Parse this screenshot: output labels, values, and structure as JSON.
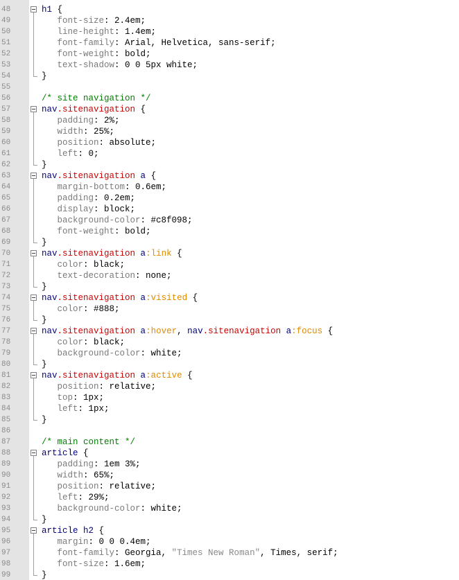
{
  "window": {
    "title": ""
  },
  "editor": {
    "lines": [
      {
        "n": "48",
        "fold": "start",
        "tokens": [
          {
            "t": "h1",
            "c": "sel"
          },
          {
            "t": " {",
            "c": "pun"
          }
        ]
      },
      {
        "n": "49",
        "fold": "mid",
        "tokens": [
          {
            "t": "   font-size",
            "c": "prop"
          },
          {
            "t": ": 2.4em;",
            "c": "val"
          }
        ]
      },
      {
        "n": "50",
        "fold": "mid",
        "tokens": [
          {
            "t": "   line-height",
            "c": "prop"
          },
          {
            "t": ": 1.4em;",
            "c": "val"
          }
        ]
      },
      {
        "n": "51",
        "fold": "mid",
        "tokens": [
          {
            "t": "   font-family",
            "c": "prop"
          },
          {
            "t": ": Arial, Helvetica, sans-serif;",
            "c": "val"
          }
        ]
      },
      {
        "n": "52",
        "fold": "mid",
        "tokens": [
          {
            "t": "   font-weight",
            "c": "prop"
          },
          {
            "t": ": bold;",
            "c": "val"
          }
        ]
      },
      {
        "n": "53",
        "fold": "mid",
        "tokens": [
          {
            "t": "   text-shadow",
            "c": "prop"
          },
          {
            "t": ": 0 0 5px white;",
            "c": "val"
          }
        ]
      },
      {
        "n": "54",
        "fold": "end",
        "tokens": [
          {
            "t": "}",
            "c": "pun"
          }
        ]
      },
      {
        "n": "55",
        "fold": "none",
        "tokens": []
      },
      {
        "n": "56",
        "fold": "none",
        "tokens": [
          {
            "t": "/* site navigation */",
            "c": "cmt"
          }
        ]
      },
      {
        "n": "57",
        "fold": "start",
        "tokens": [
          {
            "t": "nav",
            "c": "sel"
          },
          {
            "t": ".sitenavigation",
            "c": "cls"
          },
          {
            "t": " {",
            "c": "pun"
          }
        ]
      },
      {
        "n": "58",
        "fold": "mid",
        "tokens": [
          {
            "t": "   padding",
            "c": "prop"
          },
          {
            "t": ": 2%;",
            "c": "val"
          }
        ]
      },
      {
        "n": "59",
        "fold": "mid",
        "tokens": [
          {
            "t": "   width",
            "c": "prop"
          },
          {
            "t": ": 25%;",
            "c": "val"
          }
        ]
      },
      {
        "n": "60",
        "fold": "mid",
        "tokens": [
          {
            "t": "   position",
            "c": "prop"
          },
          {
            "t": ": absolute;",
            "c": "val"
          }
        ]
      },
      {
        "n": "61",
        "fold": "mid",
        "tokens": [
          {
            "t": "   left",
            "c": "prop"
          },
          {
            "t": ": 0;",
            "c": "val"
          }
        ]
      },
      {
        "n": "62",
        "fold": "end",
        "tokens": [
          {
            "t": "}",
            "c": "pun"
          }
        ]
      },
      {
        "n": "63",
        "fold": "start",
        "tokens": [
          {
            "t": "nav",
            "c": "sel"
          },
          {
            "t": ".sitenavigation",
            "c": "cls"
          },
          {
            "t": " a",
            "c": "sel"
          },
          {
            "t": " {",
            "c": "pun"
          }
        ]
      },
      {
        "n": "64",
        "fold": "mid",
        "tokens": [
          {
            "t": "   margin-bottom",
            "c": "prop"
          },
          {
            "t": ": 0.6em;",
            "c": "val"
          }
        ]
      },
      {
        "n": "65",
        "fold": "mid",
        "tokens": [
          {
            "t": "   padding",
            "c": "prop"
          },
          {
            "t": ": 0.2em;",
            "c": "val"
          }
        ]
      },
      {
        "n": "66",
        "fold": "mid",
        "tokens": [
          {
            "t": "   display",
            "c": "prop"
          },
          {
            "t": ": block;",
            "c": "val"
          }
        ]
      },
      {
        "n": "67",
        "fold": "mid",
        "tokens": [
          {
            "t": "   background-color",
            "c": "prop"
          },
          {
            "t": ": #c8f098;",
            "c": "val"
          }
        ]
      },
      {
        "n": "68",
        "fold": "mid",
        "tokens": [
          {
            "t": "   font-weight",
            "c": "prop"
          },
          {
            "t": ": bold;",
            "c": "val"
          }
        ]
      },
      {
        "n": "69",
        "fold": "end",
        "tokens": [
          {
            "t": "}",
            "c": "pun"
          }
        ]
      },
      {
        "n": "70",
        "fold": "start",
        "tokens": [
          {
            "t": "nav",
            "c": "sel"
          },
          {
            "t": ".sitenavigation",
            "c": "cls"
          },
          {
            "t": " a",
            "c": "sel"
          },
          {
            "t": ":link",
            "c": "pseudo"
          },
          {
            "t": " {",
            "c": "pun"
          }
        ]
      },
      {
        "n": "71",
        "fold": "mid",
        "tokens": [
          {
            "t": "   color",
            "c": "prop"
          },
          {
            "t": ": black;",
            "c": "val"
          }
        ]
      },
      {
        "n": "72",
        "fold": "mid",
        "tokens": [
          {
            "t": "   text-decoration",
            "c": "prop"
          },
          {
            "t": ": none;",
            "c": "val"
          }
        ]
      },
      {
        "n": "73",
        "fold": "end",
        "tokens": [
          {
            "t": "}",
            "c": "pun"
          }
        ]
      },
      {
        "n": "74",
        "fold": "start",
        "tokens": [
          {
            "t": "nav",
            "c": "sel"
          },
          {
            "t": ".sitenavigation",
            "c": "cls"
          },
          {
            "t": " a",
            "c": "sel"
          },
          {
            "t": ":visited",
            "c": "pseudo"
          },
          {
            "t": " {",
            "c": "pun"
          }
        ]
      },
      {
        "n": "75",
        "fold": "mid",
        "tokens": [
          {
            "t": "   color",
            "c": "prop"
          },
          {
            "t": ": #888;",
            "c": "val"
          }
        ]
      },
      {
        "n": "76",
        "fold": "end",
        "tokens": [
          {
            "t": "}",
            "c": "pun"
          }
        ]
      },
      {
        "n": "77",
        "fold": "start",
        "tokens": [
          {
            "t": "nav",
            "c": "sel"
          },
          {
            "t": ".sitenavigation",
            "c": "cls"
          },
          {
            "t": " a",
            "c": "sel"
          },
          {
            "t": ":hover",
            "c": "pseudo"
          },
          {
            "t": ", ",
            "c": "pun"
          },
          {
            "t": "nav",
            "c": "sel"
          },
          {
            "t": ".sitenavigation",
            "c": "cls"
          },
          {
            "t": " a",
            "c": "sel"
          },
          {
            "t": ":focus",
            "c": "pseudo"
          },
          {
            "t": " {",
            "c": "pun"
          }
        ]
      },
      {
        "n": "78",
        "fold": "mid",
        "tokens": [
          {
            "t": "   color",
            "c": "prop"
          },
          {
            "t": ": black;",
            "c": "val"
          }
        ]
      },
      {
        "n": "79",
        "fold": "mid",
        "tokens": [
          {
            "t": "   background-color",
            "c": "prop"
          },
          {
            "t": ": white;",
            "c": "val"
          }
        ]
      },
      {
        "n": "80",
        "fold": "end",
        "tokens": [
          {
            "t": "}",
            "c": "pun"
          }
        ]
      },
      {
        "n": "81",
        "fold": "start",
        "tokens": [
          {
            "t": "nav",
            "c": "sel"
          },
          {
            "t": ".sitenavigation",
            "c": "cls"
          },
          {
            "t": " a",
            "c": "sel"
          },
          {
            "t": ":active",
            "c": "pseudo"
          },
          {
            "t": " {",
            "c": "pun"
          }
        ]
      },
      {
        "n": "82",
        "fold": "mid",
        "tokens": [
          {
            "t": "   position",
            "c": "prop"
          },
          {
            "t": ": relative;",
            "c": "val"
          }
        ]
      },
      {
        "n": "83",
        "fold": "mid",
        "tokens": [
          {
            "t": "   top",
            "c": "prop"
          },
          {
            "t": ": 1px;",
            "c": "val"
          }
        ]
      },
      {
        "n": "84",
        "fold": "mid",
        "tokens": [
          {
            "t": "   left",
            "c": "prop"
          },
          {
            "t": ": 1px;",
            "c": "val"
          }
        ]
      },
      {
        "n": "85",
        "fold": "end",
        "tokens": [
          {
            "t": "}",
            "c": "pun"
          }
        ]
      },
      {
        "n": "86",
        "fold": "none",
        "tokens": []
      },
      {
        "n": "87",
        "fold": "none",
        "tokens": [
          {
            "t": "/* main content */",
            "c": "cmt"
          }
        ]
      },
      {
        "n": "88",
        "fold": "start",
        "tokens": [
          {
            "t": "article",
            "c": "sel"
          },
          {
            "t": " {",
            "c": "pun"
          }
        ]
      },
      {
        "n": "89",
        "fold": "mid",
        "tokens": [
          {
            "t": "   padding",
            "c": "prop"
          },
          {
            "t": ": 1em 3%;",
            "c": "val"
          }
        ]
      },
      {
        "n": "90",
        "fold": "mid",
        "tokens": [
          {
            "t": "   width",
            "c": "prop"
          },
          {
            "t": ": 65%;",
            "c": "val"
          }
        ]
      },
      {
        "n": "91",
        "fold": "mid",
        "tokens": [
          {
            "t": "   position",
            "c": "prop"
          },
          {
            "t": ": relative;",
            "c": "val"
          }
        ]
      },
      {
        "n": "92",
        "fold": "mid",
        "tokens": [
          {
            "t": "   left",
            "c": "prop"
          },
          {
            "t": ": 29%;",
            "c": "val"
          }
        ]
      },
      {
        "n": "93",
        "fold": "mid",
        "tokens": [
          {
            "t": "   background-color",
            "c": "prop"
          },
          {
            "t": ": white;",
            "c": "val"
          }
        ]
      },
      {
        "n": "94",
        "fold": "end",
        "tokens": [
          {
            "t": "}",
            "c": "pun"
          }
        ]
      },
      {
        "n": "95",
        "fold": "start",
        "tokens": [
          {
            "t": "article h2",
            "c": "sel"
          },
          {
            "t": " {",
            "c": "pun"
          }
        ]
      },
      {
        "n": "96",
        "fold": "mid",
        "tokens": [
          {
            "t": "   margin",
            "c": "prop"
          },
          {
            "t": ": 0 0 0.4em;",
            "c": "val"
          }
        ]
      },
      {
        "n": "97",
        "fold": "mid",
        "tokens": [
          {
            "t": "   font-family",
            "c": "prop"
          },
          {
            "t": ": Georgia, ",
            "c": "val"
          },
          {
            "t": "\"Times New Roman\"",
            "c": "str"
          },
          {
            "t": ", Times, serif;",
            "c": "val"
          }
        ]
      },
      {
        "n": "98",
        "fold": "mid",
        "tokens": [
          {
            "t": "   font-size",
            "c": "prop"
          },
          {
            "t": ": 1.6em;",
            "c": "val"
          }
        ]
      },
      {
        "n": "99",
        "fold": "end",
        "tokens": [
          {
            "t": "}",
            "c": "pun"
          }
        ]
      }
    ]
  },
  "colors": {
    "gutter_bg": "#e4e4e4",
    "selector": "#000080",
    "class_name": "#cc0000",
    "pseudo_class": "#e08a00",
    "property": "#7a7a7a",
    "value": "#000000",
    "string": "#888888",
    "comment": "#008000",
    "line_number": "#8a8a8a"
  }
}
